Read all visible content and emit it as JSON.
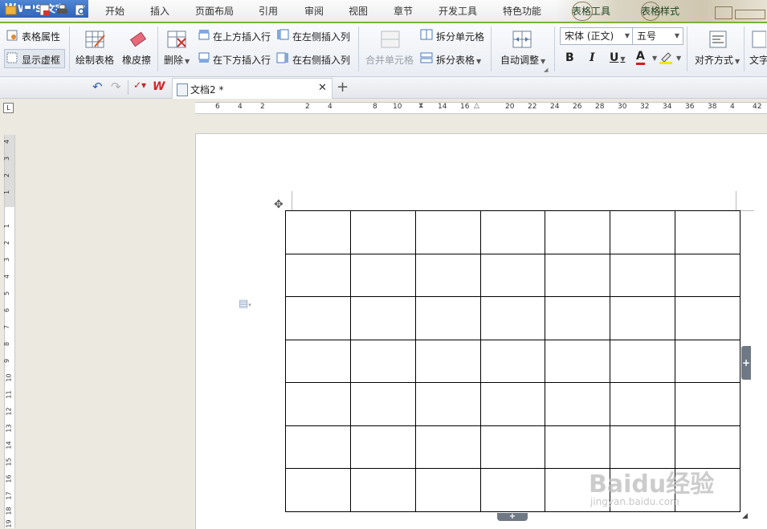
{
  "app": {
    "name": "WPS 文字"
  },
  "menu": [
    "开始",
    "插入",
    "页面布局",
    "引用",
    "审阅",
    "视图",
    "章节",
    "开发工具",
    "特色功能",
    "表格工具",
    "表格样式"
  ],
  "ribbon": {
    "table_props": "表格属性",
    "show_gridlines": "显示虚框",
    "draw_table": "绘制表格",
    "eraser": "橡皮擦",
    "delete": "删除",
    "insert_row_above": "在上方插入行",
    "insert_row_below": "在下方插入行",
    "insert_col_left": "在左侧插入列",
    "insert_col_right": "在右侧插入列",
    "merge_cells": "合并单元格",
    "split_cells": "拆分单元格",
    "split_table": "拆分表格",
    "auto_fit": "自动调整",
    "font_name": "宋体 (正文)",
    "font_size": "五号",
    "bold": "B",
    "italic": "I",
    "underline": "U",
    "font_color": "A",
    "align": "对齐方式",
    "text_dir": "文字"
  },
  "tabs": {
    "doc_title": "文档2 *",
    "close": "✕",
    "new": "+"
  },
  "ruler": {
    "h_ticks": [
      "6",
      "4",
      "2",
      "2",
      "4",
      "8",
      "10",
      "14",
      "16",
      "20",
      "22",
      "24",
      "26",
      "28",
      "30",
      "32",
      "34",
      "36",
      "38",
      "4",
      "42"
    ],
    "v_ticks": [
      "4",
      "3",
      "2",
      "1",
      "1",
      "2",
      "3",
      "4",
      "5",
      "6",
      "7",
      "8",
      "9",
      "10",
      "11",
      "12",
      "13",
      "14",
      "15",
      "16",
      "17",
      "18",
      "19"
    ]
  },
  "table": {
    "rows": 7,
    "cols": 7
  },
  "watermark": {
    "brand": "Baidu经验",
    "url": "jingyan.baidu.com"
  },
  "colors": {
    "accent": "#2e63b8",
    "menu_underline": "#7fae3b"
  }
}
